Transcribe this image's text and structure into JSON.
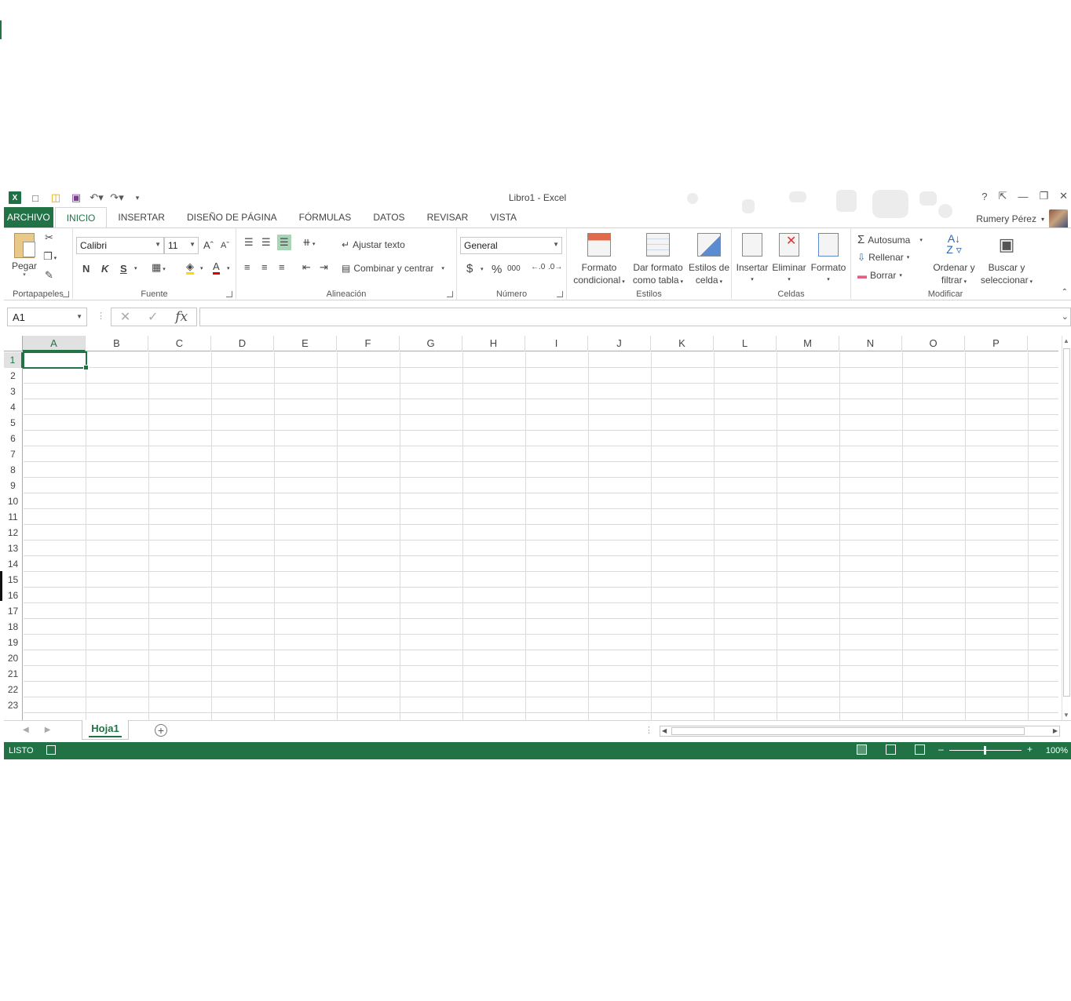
{
  "window": {
    "title": "Libro1 - Excel"
  },
  "qat": {
    "icons": [
      "excel-logo",
      "new-icon",
      "open-icon",
      "save-icon",
      "undo-icon",
      "redo-icon",
      "customize-icon"
    ]
  },
  "tabs": [
    {
      "label": "ARCHIVO"
    },
    {
      "label": "INICIO"
    },
    {
      "label": "INSERTAR"
    },
    {
      "label": "DISEÑO DE PÁGINA"
    },
    {
      "label": "FÓRMULAS"
    },
    {
      "label": "DATOS"
    },
    {
      "label": "REVISAR"
    },
    {
      "label": "VISTA"
    }
  ],
  "user": {
    "name": "Rumery Pérez"
  },
  "ribbon": {
    "clipboard": {
      "paste_label": "Pegar",
      "group_label": "Portapapeles"
    },
    "font": {
      "font_name": "Calibri",
      "font_size": "11",
      "bold": "N",
      "italic": "K",
      "underline": "S",
      "group_label": "Fuente"
    },
    "alignment": {
      "wrap_label": "Ajustar texto",
      "merge_label": "Combinar y centrar",
      "group_label": "Alineación"
    },
    "number": {
      "format": "General",
      "currency": "$",
      "percent": "%",
      "thousands": "000",
      "group_label": "Número"
    },
    "styles": {
      "cond_format_l1": "Formato",
      "cond_format_l2": "condicional",
      "table_format_l1": "Dar formato",
      "table_format_l2": "como tabla",
      "cell_styles_l1": "Estilos de",
      "cell_styles_l2": "celda",
      "group_label": "Estilos"
    },
    "cells": {
      "insert_label": "Insertar",
      "delete_label": "Eliminar",
      "format_label": "Formato",
      "group_label": "Celdas"
    },
    "editing": {
      "autosum_label": "Autosuma",
      "fill_label": "Rellenar",
      "clear_label": "Borrar",
      "sort_l1": "Ordenar y",
      "sort_l2": "filtrar",
      "find_l1": "Buscar y",
      "find_l2": "seleccionar",
      "group_label": "Modificar"
    }
  },
  "formula_bar": {
    "name_box": "A1",
    "fx": "fx",
    "value": ""
  },
  "grid": {
    "columns": [
      "A",
      "B",
      "C",
      "D",
      "E",
      "F",
      "G",
      "H",
      "I",
      "J",
      "K",
      "L",
      "M",
      "N",
      "O",
      "P"
    ],
    "rows": [
      "1",
      "2",
      "3",
      "4",
      "5",
      "6",
      "7",
      "8",
      "9",
      "10",
      "11",
      "12",
      "13",
      "14",
      "15",
      "16",
      "17",
      "18",
      "19",
      "20",
      "21",
      "22",
      "23"
    ],
    "active_cell": "A1"
  },
  "sheets": [
    {
      "name": "Hoja1",
      "active": true
    }
  ],
  "status": {
    "ready": "LISTO",
    "zoom": "100%"
  },
  "colors": {
    "accent": "#217346"
  }
}
